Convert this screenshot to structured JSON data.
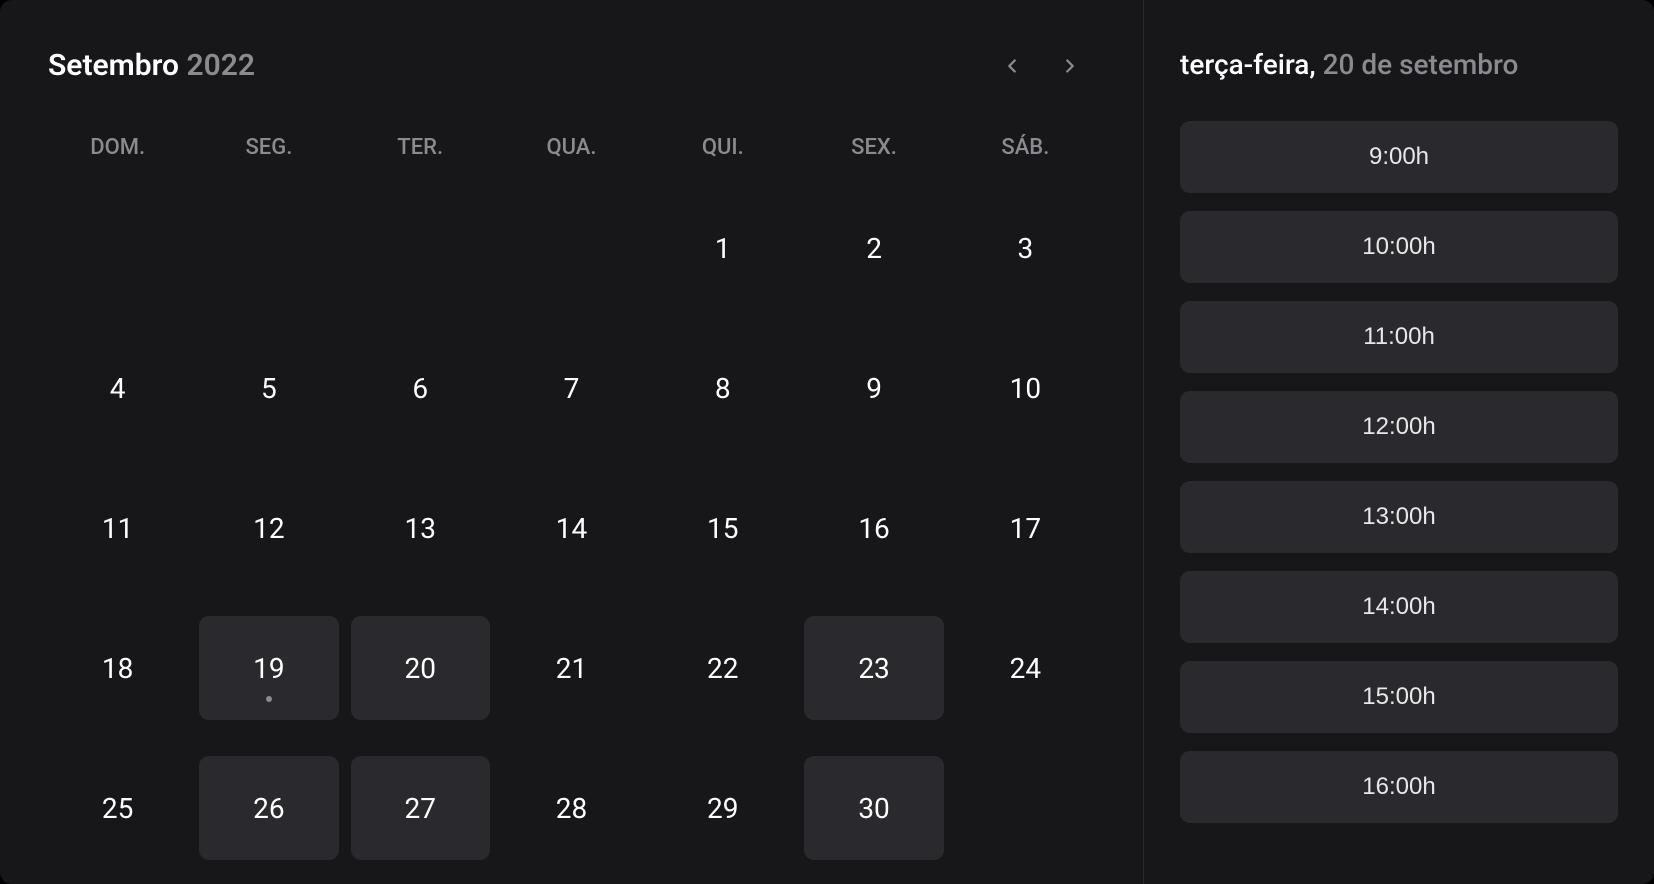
{
  "header": {
    "month": "Setembro",
    "year": "2022"
  },
  "weekdays": [
    "DOM.",
    "SEG.",
    "TER.",
    "QUA.",
    "QUI.",
    "SEX.",
    "SÁB."
  ],
  "days": [
    {
      "label": "",
      "empty": true
    },
    {
      "label": "",
      "empty": true
    },
    {
      "label": "",
      "empty": true
    },
    {
      "label": "",
      "empty": true
    },
    {
      "label": "1"
    },
    {
      "label": "2"
    },
    {
      "label": "3"
    },
    {
      "label": "4"
    },
    {
      "label": "5"
    },
    {
      "label": "6"
    },
    {
      "label": "7"
    },
    {
      "label": "8"
    },
    {
      "label": "9"
    },
    {
      "label": "10"
    },
    {
      "label": "11"
    },
    {
      "label": "12"
    },
    {
      "label": "13"
    },
    {
      "label": "14"
    },
    {
      "label": "15"
    },
    {
      "label": "16"
    },
    {
      "label": "17"
    },
    {
      "label": "18"
    },
    {
      "label": "19",
      "highlighted": true,
      "today": true
    },
    {
      "label": "20",
      "highlighted": true
    },
    {
      "label": "21"
    },
    {
      "label": "22"
    },
    {
      "label": "23",
      "highlighted": true
    },
    {
      "label": "24"
    },
    {
      "label": "25"
    },
    {
      "label": "26",
      "highlighted": true
    },
    {
      "label": "27",
      "highlighted": true
    },
    {
      "label": "28"
    },
    {
      "label": "29"
    },
    {
      "label": "30",
      "highlighted": true
    }
  ],
  "selected": {
    "dayName": "terça-feira,",
    "dateText": " 20 de setembro"
  },
  "timeSlots": [
    "9:00h",
    "10:00h",
    "11:00h",
    "12:00h",
    "13:00h",
    "14:00h",
    "15:00h",
    "16:00h"
  ]
}
